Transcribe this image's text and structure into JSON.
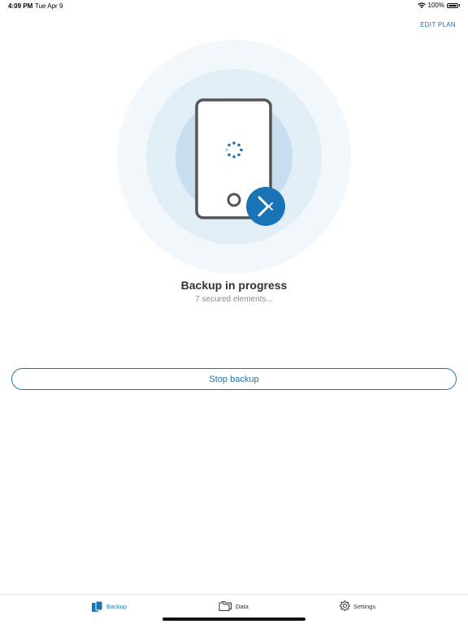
{
  "status_bar": {
    "time": "4:09 PM",
    "date": "Tue Apr 9",
    "battery": "100%"
  },
  "header": {
    "edit_plan": "EDIT PLAN"
  },
  "backup": {
    "title": "Backup in progress",
    "subtitle": "7 secured elements...",
    "stop_label": "Stop backup"
  },
  "tabs": [
    {
      "label": "Backup",
      "icon": "backup-icon",
      "active": true
    },
    {
      "label": "Data",
      "icon": "folder-icon",
      "active": false
    },
    {
      "label": "Settings",
      "icon": "gear-icon",
      "active": false
    }
  ],
  "colors": {
    "accent": "#1a73b5",
    "ring_outer": "#f1f7fb",
    "ring_middle": "#e1eef6",
    "ring_inner": "#c8def0",
    "phone_border": "#555555"
  }
}
